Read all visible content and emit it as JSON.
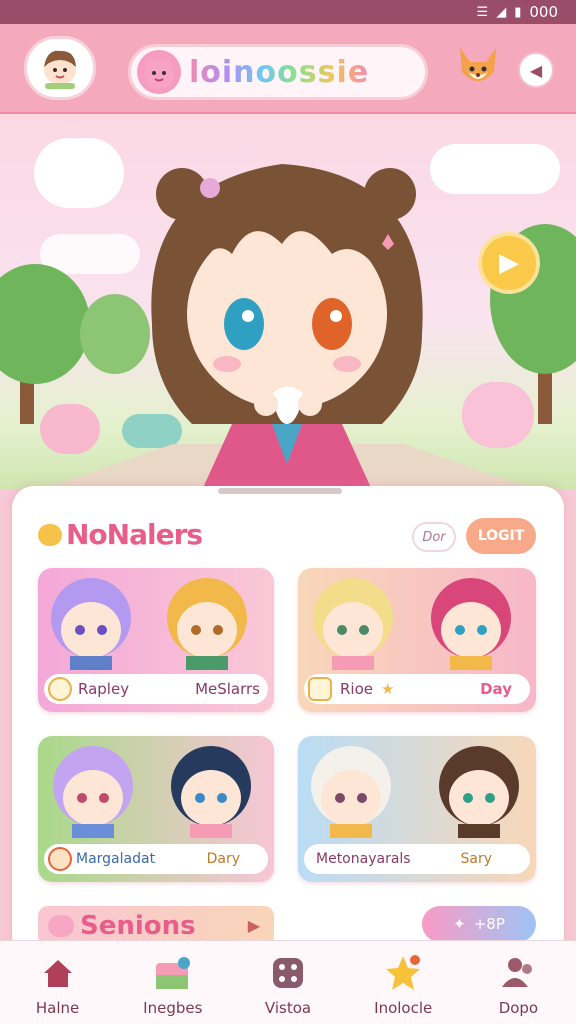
{
  "status_bar": {
    "time": "000"
  },
  "header": {
    "logo_text": "loinoossie"
  },
  "featured": {
    "title": "NoNalers",
    "ghost_button": "Dor",
    "action_button": "LOGIT"
  },
  "cards": [
    {
      "left_label": "Rapley",
      "right_label": "MeSlarrs"
    },
    {
      "left_label": "Rioe",
      "right_label": "Day"
    },
    {
      "left_label": "Margaladat",
      "right_label": "Dary"
    },
    {
      "left_label": "Metonayarals",
      "right_label": "Sary"
    }
  ],
  "seniors": {
    "title": "Senions",
    "pill_label": "+8P"
  },
  "nav": [
    {
      "label": "Halne",
      "icon": "home-icon"
    },
    {
      "label": "Inegbes",
      "icon": "gallery-icon"
    },
    {
      "label": "Vistoa",
      "icon": "dice-icon"
    },
    {
      "label": "Inolocle",
      "icon": "star-icon"
    },
    {
      "label": "Dopo",
      "icon": "people-icon"
    }
  ],
  "colors": {
    "accent": "#e85d8a",
    "header": "#f5a9bd",
    "statusbar": "#9a4d68"
  }
}
